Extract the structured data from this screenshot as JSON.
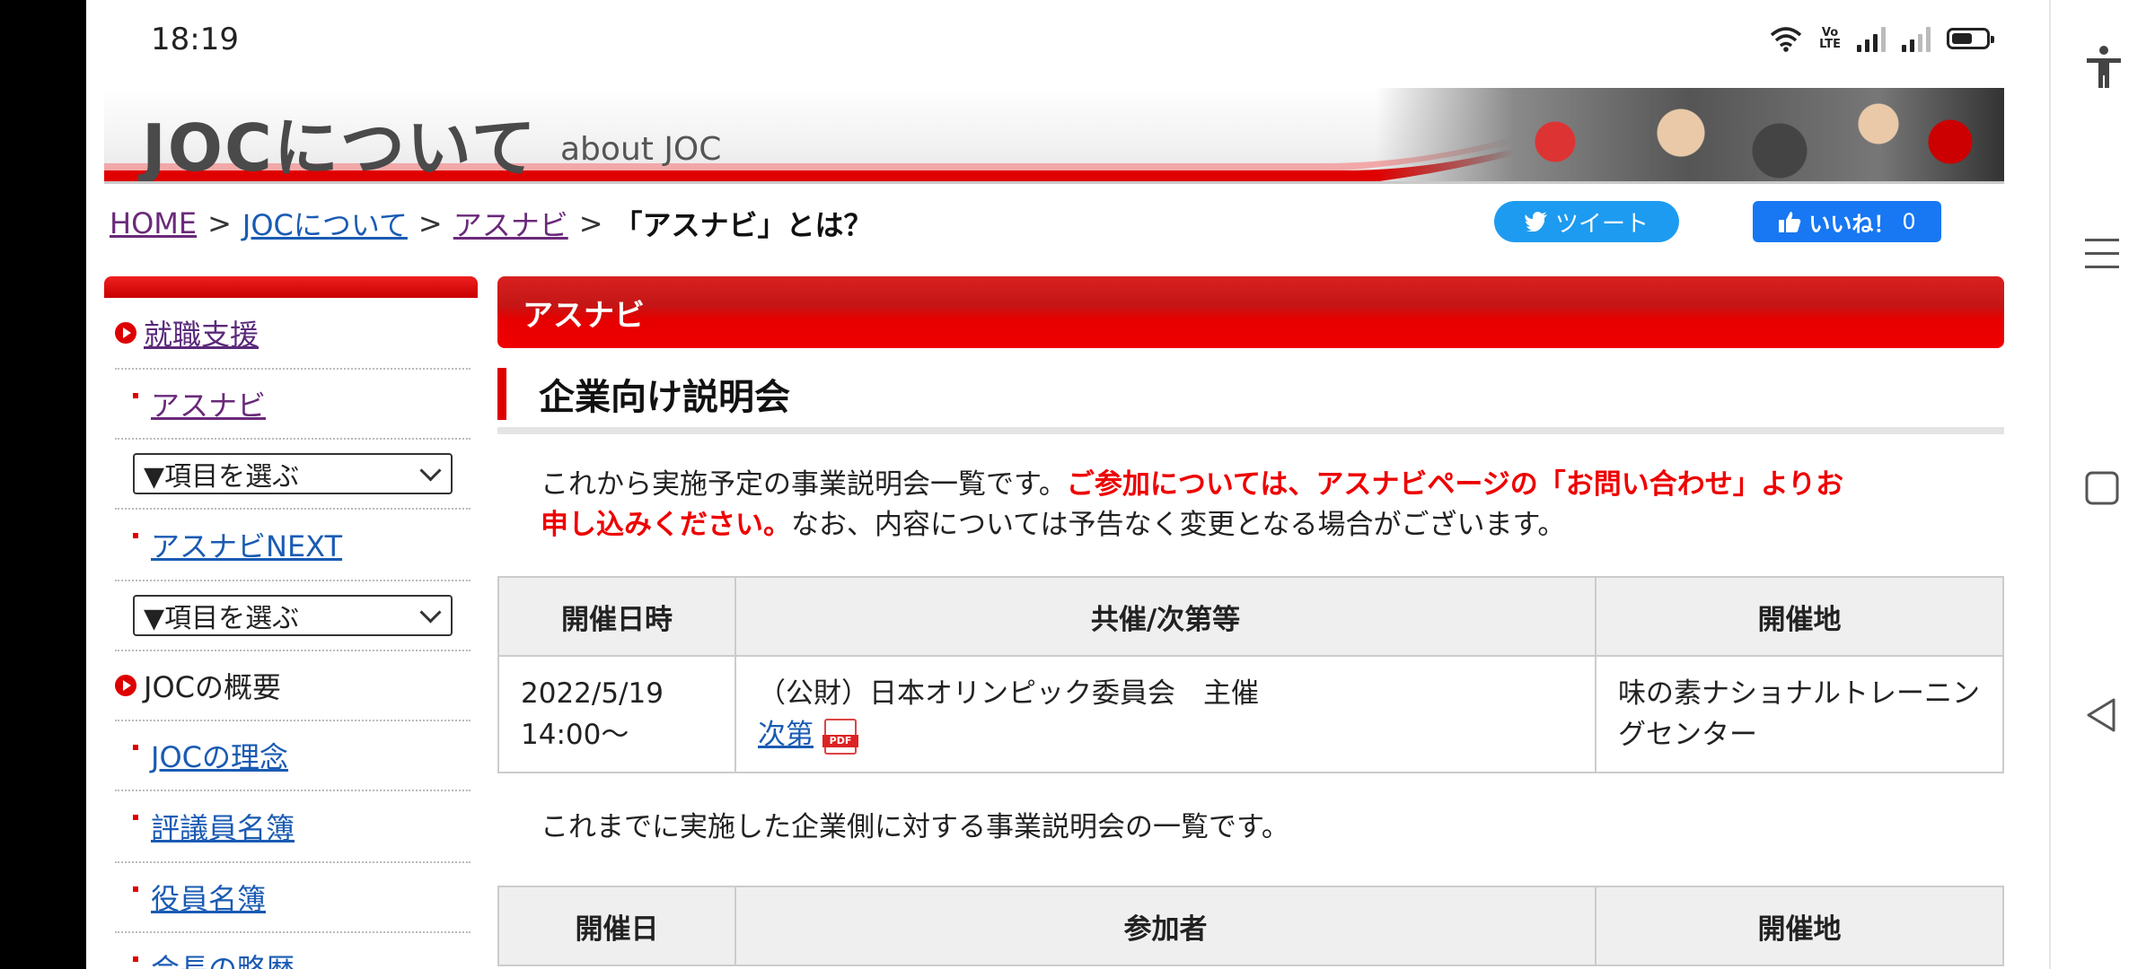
{
  "status": {
    "time": "18:19",
    "volte": "VoLTE",
    "colors": {
      "bar": "#222222"
    }
  },
  "header": {
    "title": "JOCについて",
    "subtitle": "about JOC"
  },
  "breadcrumb": {
    "home": "HOME",
    "sep": ">",
    "about": "JOCについて",
    "athnavi": "アスナビ",
    "current": "「アスナビ」とは？"
  },
  "social": {
    "tweet": "ツイート",
    "like": "いいね！",
    "like_count": "0"
  },
  "sidebar": {
    "career_support": "就職支援",
    "athnavi": "アスナビ",
    "select1": "▼項目を選ぶ",
    "athnavi_next": "アスナビNEXT",
    "select2": "▼項目を選ぶ",
    "overview": "JOCの概要",
    "philosophy": "JOCの理念",
    "councilors": "評議員名簿",
    "officers": "役員名簿",
    "president": "会長の略歴"
  },
  "main": {
    "section": "アスナビ",
    "heading": "企業向け説明会",
    "intro_plain1": "これから実施予定の事業説明会一覧です。",
    "intro_red": "ご参加については、アスナビページの「お問い合わせ」よりお申し込みください。",
    "intro_plain2": "なお、内容については予告なく変更となる場合がございます。",
    "upcoming": {
      "headers": [
        "開催日時",
        "共催/次第等",
        "開催地"
      ],
      "rows": [
        {
          "date": "2022/5/19",
          "time": "14:00〜",
          "host": "（公財）日本オリンピック委員会　主催",
          "agenda_link": "次第",
          "venue": "味の素ナショナルトレーニングセンター"
        }
      ]
    },
    "past_intro": "これまでに実施した企業側に対する事業説明会の一覧です。",
    "past": {
      "headers": [
        "開催日",
        "参加者",
        "開催地"
      ]
    }
  },
  "colors": {
    "accent_red": "#e00000",
    "link_blue": "#1a5bb3",
    "link_visited": "#6a2a7a",
    "twitter": "#1d9bf0",
    "facebook": "#1877f2"
  }
}
